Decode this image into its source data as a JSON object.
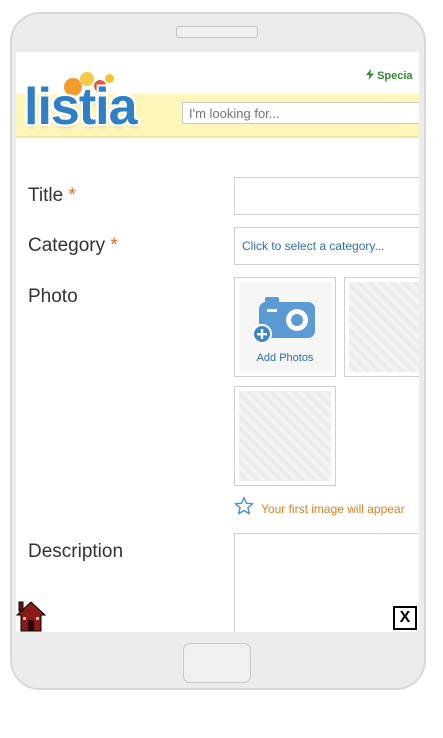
{
  "header": {
    "logo_text": "listia",
    "special_link": "Specia",
    "search_placeholder": "I'm looking for..."
  },
  "form": {
    "title_label": "Title",
    "required_mark": "*",
    "category_label": "Category",
    "category_placeholder": "Click to select a category...",
    "photo_label": "Photo",
    "add_photos_label": "Add Photos",
    "photo_hint": "Your first image will appear",
    "description_label": "Description"
  },
  "toolbar": {
    "close_label": "X"
  },
  "icons": [
    "lightning-icon",
    "camera-add-icon",
    "star-outline-icon",
    "home-icon",
    "close-icon"
  ],
  "colors": {
    "brand_blue": "#2f7fc5",
    "header_yellow": "#fdf6bb",
    "required_orange": "#e26b2a",
    "hint_orange": "#e67e22",
    "special_green": "#2e8b2e"
  }
}
